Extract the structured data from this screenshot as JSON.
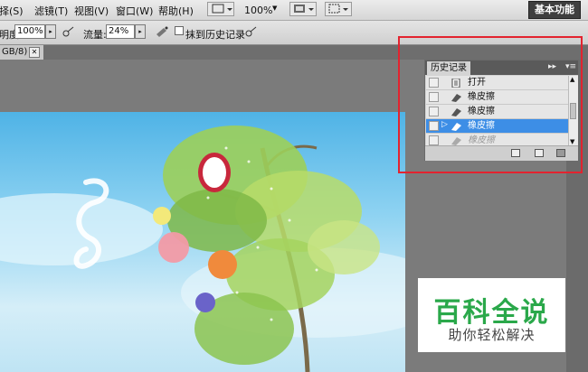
{
  "menu": {
    "items": [
      "选择(S)",
      "滤镜(T)",
      "视图(V)",
      "窗口(W)",
      "帮助(H)"
    ],
    "zoom_display": "100%",
    "workspace": "基本功能"
  },
  "options": {
    "opacity_label": "透明度:",
    "opacity_value": "100%",
    "flow_label": "流量:",
    "flow_value": "24%",
    "erase_history_label": "抹到历史记录"
  },
  "document": {
    "tab_label": "GB/8) *"
  },
  "history_panel": {
    "tab_label": "历史记录",
    "rows": [
      {
        "label": "打开",
        "icon": "open-doc-icon",
        "state": "normal"
      },
      {
        "label": "橡皮擦",
        "icon": "eraser-icon",
        "state": "normal"
      },
      {
        "label": "橡皮擦",
        "icon": "eraser-icon",
        "state": "normal"
      },
      {
        "label": "橡皮擦",
        "icon": "eraser-icon",
        "state": "selected"
      },
      {
        "label": "橡皮擦",
        "icon": "eraser-icon",
        "state": "dimmed"
      }
    ]
  },
  "watermark": {
    "title": "百科全说",
    "subtitle": "助你轻松解决"
  },
  "colors": {
    "highlight": "#3d8ee6",
    "annotation": "#e3232f",
    "watermark_green": "#2aa84a"
  }
}
